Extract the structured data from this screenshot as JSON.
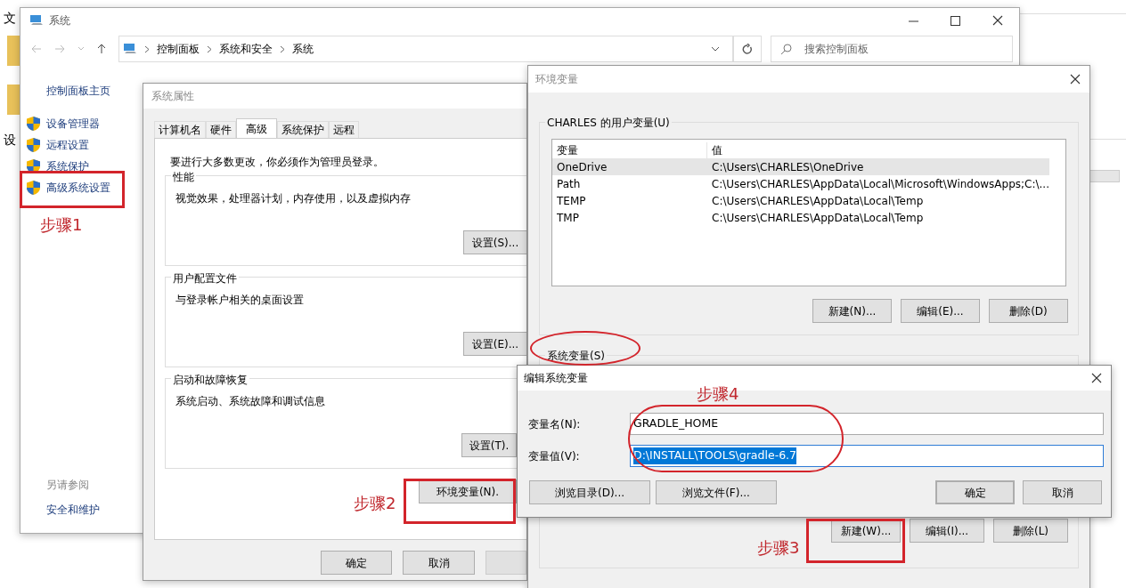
{
  "desktop": {
    "labels": [
      "文",
      "设"
    ]
  },
  "system_window": {
    "title": "系统",
    "breadcrumb": [
      "控制面板",
      "系统和安全",
      "系统"
    ],
    "search": {
      "placeholder": "搜索控制面板"
    },
    "sidebar": {
      "home": "控制面板主页",
      "items": [
        {
          "label": "设备管理器"
        },
        {
          "label": "远程设置"
        },
        {
          "label": "系统保护"
        },
        {
          "label": "高级系统设置"
        }
      ]
    },
    "see_also": {
      "heading": "另请参阅",
      "links": [
        "安全和维护"
      ]
    }
  },
  "system_properties": {
    "title": "系统属性",
    "tabs": [
      {
        "label": "计算机名",
        "selected": false
      },
      {
        "label": "硬件",
        "selected": false
      },
      {
        "label": "高级",
        "selected": true
      },
      {
        "label": "系统保护",
        "selected": false
      },
      {
        "label": "远程",
        "selected": false
      }
    ],
    "notice": "要进行大多数更改，你必须作为管理员登录。",
    "groups": [
      {
        "title": "性能",
        "description": "视觉效果，处理器计划，内存使用，以及虚拟内存",
        "button": "设置(S)..."
      },
      {
        "title": "用户配置文件",
        "description": "与登录帐户相关的桌面设置",
        "button": "设置(E)..."
      },
      {
        "title": "启动和故障恢复",
        "description": "系统启动、系统故障和调试信息",
        "button": "设置(T)."
      }
    ],
    "env_button": "环境变量(N).",
    "buttons": [
      "确定",
      "取消"
    ]
  },
  "env_vars": {
    "title": "环境变量",
    "user_group": "CHARLES 的用户变量(U)",
    "columns": [
      "变量",
      "值"
    ],
    "rows": [
      {
        "name": "OneDrive",
        "value": "C:\\Users\\CHARLES\\OneDrive",
        "selected": true
      },
      {
        "name": "Path",
        "value": "C:\\Users\\CHARLES\\AppData\\Local\\Microsoft\\WindowsApps;C:\\...",
        "selected": false
      },
      {
        "name": "TEMP",
        "value": "C:\\Users\\CHARLES\\AppData\\Local\\Temp",
        "selected": false
      },
      {
        "name": "TMP",
        "value": "C:\\Users\\CHARLES\\AppData\\Local\\Temp",
        "selected": false
      }
    ],
    "user_buttons": [
      "新建(N)...",
      "编辑(E)...",
      "删除(D)"
    ],
    "system_group": "系统变量(S)",
    "system_buttons": [
      "新建(W)...",
      "编辑(I)...",
      "删除(L)"
    ]
  },
  "edit_dialog": {
    "title": "编辑系统变量",
    "fields": [
      {
        "label": "变量名(N):",
        "value": "GRADLE_HOME",
        "selected": false
      },
      {
        "label": "变量值(V):",
        "value": "D:\\INSTALL\\TOOLS\\gradle-6.7",
        "selected": true
      }
    ],
    "browse_buttons": [
      "浏览目录(D)...",
      "浏览文件(F)..."
    ],
    "buttons": [
      {
        "label": "确定",
        "default": true
      },
      {
        "label": "取消",
        "default": false
      }
    ]
  },
  "annotations": [
    {
      "text": "步骤1"
    },
    {
      "text": "步骤2"
    },
    {
      "text": "步骤3"
    },
    {
      "text": "步骤4"
    }
  ]
}
